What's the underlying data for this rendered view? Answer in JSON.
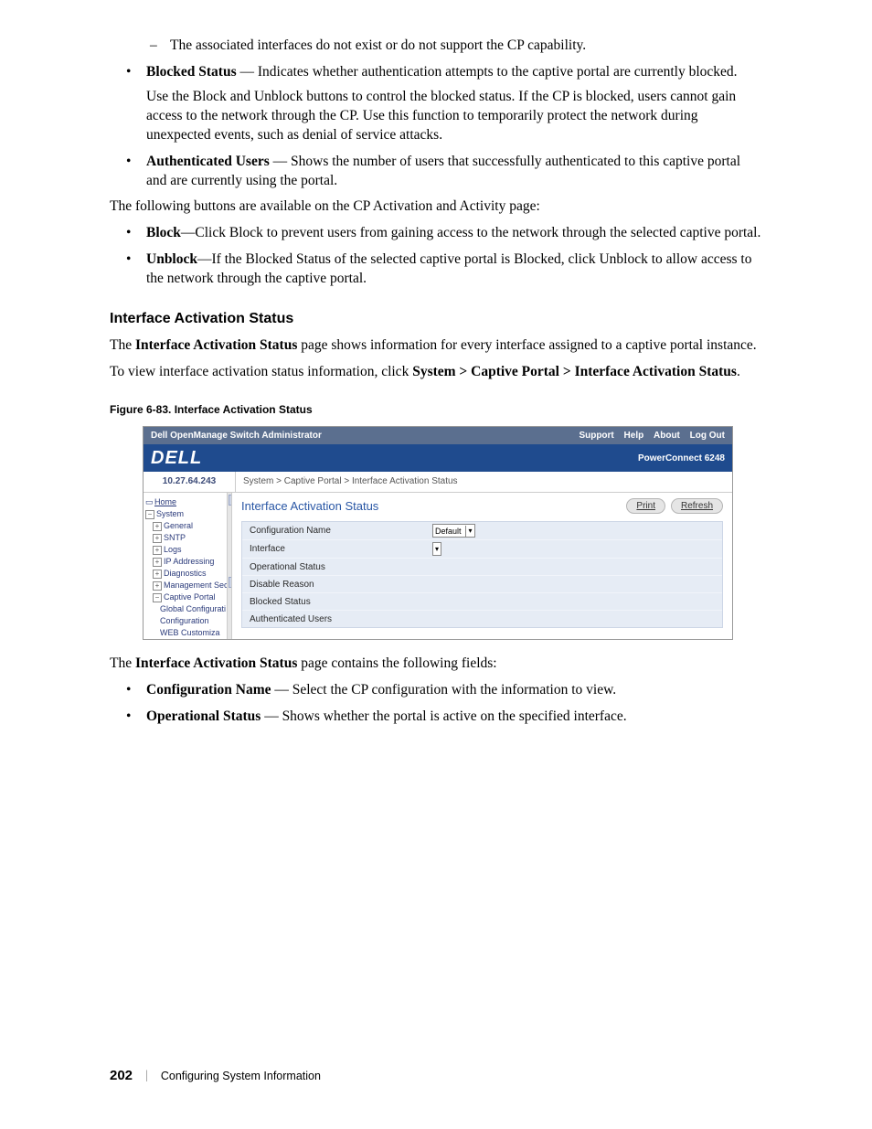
{
  "doc": {
    "sub_bullet": "The associated interfaces do not exist or do not support the CP capability.",
    "blocked_status_label": "Blocked Status",
    "blocked_status_text": " — Indicates whether authentication attempts to the captive portal are currently blocked.",
    "blocked_status_extra": "Use the Block and Unblock buttons to control the blocked status. If the CP is blocked, users cannot gain access to the network through the CP. Use this function to temporarily protect the network during unexpected events, such as denial of service attacks.",
    "auth_users_label": "Authenticated Users",
    "auth_users_text": " — Shows the number of users that successfully authenticated to this captive portal and are currently using the portal.",
    "buttons_intro": "The following buttons are available on the CP Activation and Activity page:",
    "block_label": "Block",
    "block_text": "—Click Block to prevent users from gaining access to the network through the selected captive portal.",
    "unblock_label": "Unblock",
    "unblock_text": "—If the Blocked Status of the selected captive portal is Blocked, click Unblock to allow access to the network through the captive portal.",
    "h2": "Interface Activation Status",
    "ias_p1a": "The ",
    "ias_p1b": "Interface Activation Status",
    "ias_p1c": " page shows information for every interface assigned to a captive portal instance.",
    "ias_p2a": "To view interface activation status information, click ",
    "ias_p2b": "System > Captive Portal > Interface Activation Status",
    "ias_p2c": ".",
    "fig_caption": "Figure 6-83.    Interface Activation Status",
    "post_fig_a": "The ",
    "post_fig_b": "Interface Activation Status",
    "post_fig_c": " page contains the following fields:",
    "cfg_name_label": "Configuration Name",
    "cfg_name_text": " — Select the CP configuration with the information to view.",
    "op_status_label": "Operational Status",
    "op_status_text": " — Shows whether the portal is active on the specified interface."
  },
  "ui": {
    "headbar_title": "Dell OpenManage Switch Administrator",
    "links": {
      "support": "Support",
      "help": "Help",
      "about": "About",
      "logout": "Log Out"
    },
    "logo": "DELL",
    "model": "PowerConnect 6248",
    "ip": "10.27.64.243",
    "crumb": "System > Captive Portal > Interface Activation Status",
    "tree": {
      "home": "Home",
      "system": "System",
      "general": "General",
      "sntp": "SNTP",
      "logs": "Logs",
      "ip": "IP Addressing",
      "diag": "Diagnostics",
      "mgmt": "Management Securi",
      "cp": "Captive Portal",
      "global": "Global Configurati",
      "config": "Configuration",
      "web": "WEB Customiza"
    },
    "title": "Interface Activation Status",
    "buttons": {
      "print": "Print",
      "refresh": "Refresh"
    },
    "rows": {
      "cfg": "Configuration Name",
      "iface": "Interface",
      "op": "Operational Status",
      "disable": "Disable Reason",
      "blocked": "Blocked Status",
      "auth": "Authenticated Users"
    },
    "default_opt": "Default"
  },
  "footer": {
    "page": "202",
    "section": "Configuring System Information"
  }
}
